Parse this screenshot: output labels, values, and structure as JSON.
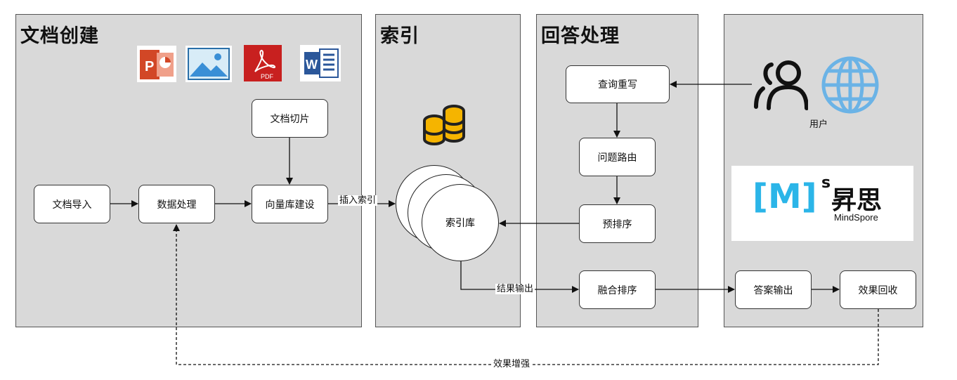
{
  "panels": {
    "doc_creation": "文档创建",
    "index": "索引",
    "answer_processing": "回答处理",
    "user_panel": ""
  },
  "nodes": {
    "doc_import": "文档导入",
    "data_processing": "数据处理",
    "doc_slicing": "文档切片",
    "vector_build": "向量库建设",
    "index_store": "索引库",
    "query_rewrite": "查询重写",
    "question_routing": "问题路由",
    "pre_ranking": "预排序",
    "fusion_ranking": "融合排序",
    "answer_output": "答案输出",
    "effect_feedback": "效果回收"
  },
  "edge_labels": {
    "insert_index": "插入索引",
    "result_output": "结果输出",
    "effect_enhance": "效果增强"
  },
  "user": {
    "label": "用户"
  },
  "brand": {
    "name_cn": "昇思",
    "name_en": "MindSpore",
    "logo_text": "[M]",
    "logo_sup": "s"
  },
  "file_icons": {
    "ppt": "P",
    "pdf": "PDF",
    "word": "W"
  },
  "colors": {
    "panel_bg": "#d9d9d9",
    "ppt": "#d24726",
    "pdf": "#c8201f",
    "word": "#2b579a",
    "image": "#3a8fd6",
    "globe": "#6bb3e6",
    "coin": "#f5b400",
    "brand_blue": "#2bb5e8"
  }
}
